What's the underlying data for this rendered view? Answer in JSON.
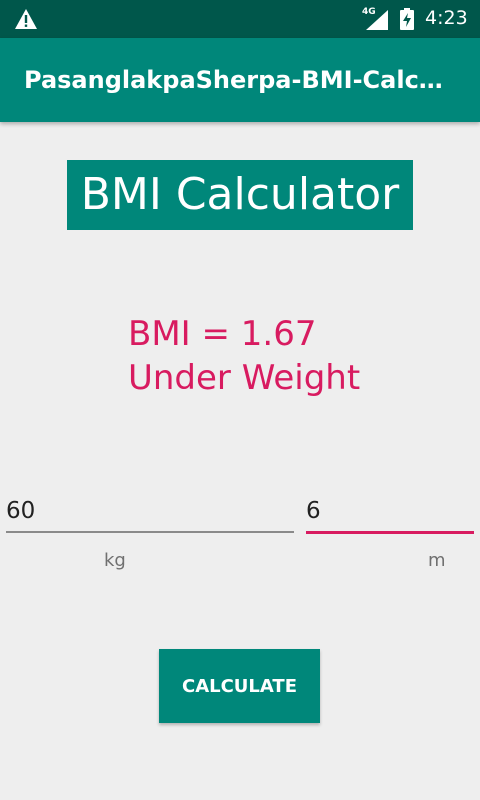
{
  "status_bar": {
    "network_label": "4G",
    "time": "4:23",
    "icons": [
      "warning-icon",
      "signal-icon",
      "battery-charging-icon"
    ]
  },
  "app_bar": {
    "title": "PasanglakpaSherpa-BMI-Calculator"
  },
  "heading": "BMI Calculator",
  "result": {
    "value_text": "BMI = 1.67",
    "category": "Under Weight"
  },
  "inputs": {
    "weight": {
      "value": "60",
      "unit": "kg"
    },
    "height": {
      "value": "6",
      "unit": "m"
    }
  },
  "button": {
    "label": "CALCULATE"
  },
  "colors": {
    "status_bar": "#00574b",
    "primary": "#00877a",
    "accent": "#d81b60",
    "background": "#eeeeee"
  }
}
